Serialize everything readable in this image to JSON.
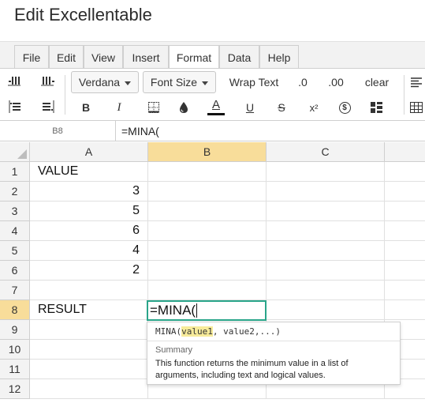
{
  "app": {
    "title": "Edit Excellentable"
  },
  "menu": {
    "tabs": [
      {
        "label": "File"
      },
      {
        "label": "Edit"
      },
      {
        "label": "View"
      },
      {
        "label": "Insert"
      },
      {
        "label": "Format"
      },
      {
        "label": "Data"
      },
      {
        "label": "Help"
      }
    ],
    "active": "Format"
  },
  "toolbar": {
    "font_family": "Verdana",
    "font_size_label": "Font Size",
    "wrap_text_label": "Wrap Text",
    "decrease_decimals_label": ".0",
    "increase_decimals_label": ".00",
    "clear_label": "clear",
    "bold_label": "B",
    "italic_label": "I",
    "text_color_label": "A",
    "underline_label": "U",
    "strike_label": "S",
    "superscript_label": "x²",
    "currency_label": "$",
    "text_color": "#111111",
    "accent_color": "#2aa58a"
  },
  "formula_bar": {
    "cell_ref": "B8",
    "value": "=MINA("
  },
  "sheet": {
    "columns": [
      "A",
      "B",
      "C"
    ],
    "selected_column": "B",
    "rows": [
      "1",
      "2",
      "3",
      "4",
      "5",
      "6",
      "7",
      "8",
      "9",
      "10",
      "11",
      "12"
    ],
    "selected_row": "8",
    "cells": {
      "A1": "VALUE",
      "A2": "3",
      "A3": "5",
      "A4": "6",
      "A5": "4",
      "A6": "2",
      "A8": "RESULT"
    },
    "editing": {
      "cell": "B8",
      "text": "=MINA("
    }
  },
  "function_tooltip": {
    "func_name": "MINA(",
    "arg_highlight": "value1",
    "args_rest": ", value2,...)",
    "summary_label": "Summary",
    "description": "This function returns the minimum value in a list of arguments, including text and logical values."
  }
}
